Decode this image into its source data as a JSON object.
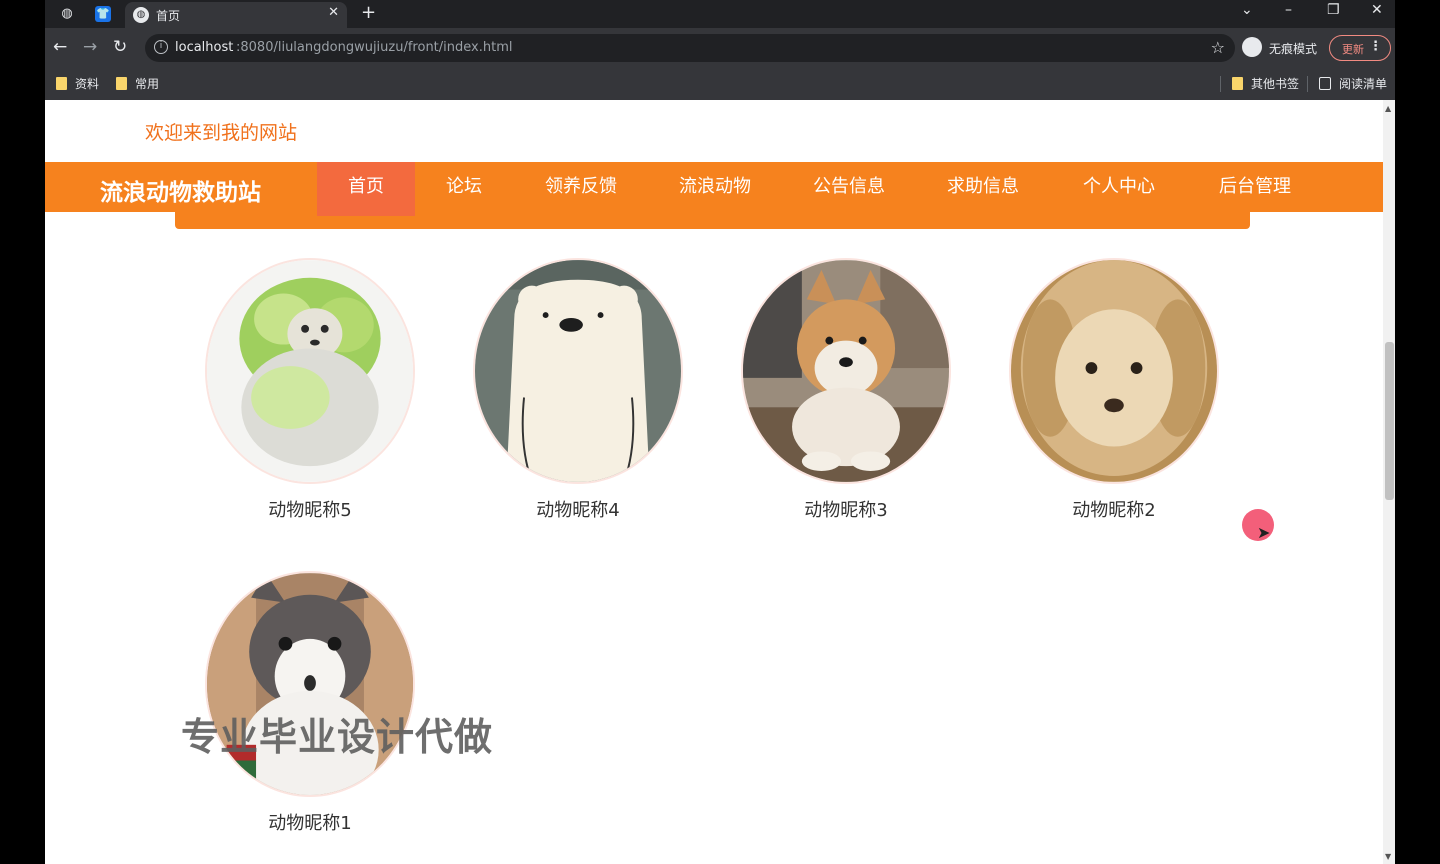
{
  "browser": {
    "tab_title": "首页",
    "tab_close": "✕",
    "new_tab": "+",
    "url_host": "localhost",
    "url_rest": ":8080/liulangdongwujiuzu/front/index.html",
    "incognito_label": "无痕模式",
    "update_label": "更新",
    "bookmarks": [
      "资料",
      "常用"
    ],
    "bookmarks_right": [
      "其他书签",
      "阅读清单"
    ]
  },
  "site": {
    "welcome": "欢迎来到我的网站",
    "brand": "流浪动物救助站",
    "nav": [
      "首页",
      "论坛",
      "领养反馈",
      "流浪动物",
      "公告信息",
      "求助信息",
      "个人中心",
      "后台管理"
    ],
    "active_nav": "首页"
  },
  "pets": [
    {
      "name": "动物昵称5",
      "image": "cabbage-dog-photo"
    },
    {
      "name": "动物昵称4",
      "image": "ice-bear-cartoon"
    },
    {
      "name": "动物昵称3",
      "image": "shiba-inu-photo"
    },
    {
      "name": "动物昵称2",
      "image": "golden-puppy-photo"
    },
    {
      "name": "动物昵称1",
      "image": "grey-white-cat-photo"
    }
  ],
  "overlay": {
    "watermark": "专业毕业设计代做"
  },
  "colors": {
    "accent": "#f6821e",
    "active_nav": "#f36a3e",
    "welcome_text": "#f0711c"
  }
}
